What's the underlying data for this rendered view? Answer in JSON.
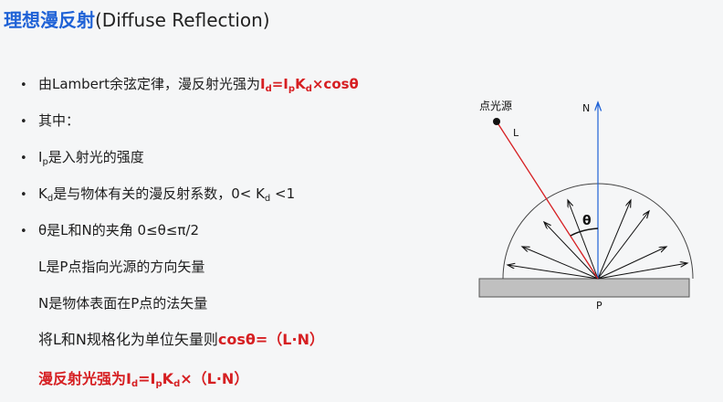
{
  "title": {
    "cn": "理想漫反射",
    "en": "(Diffuse Reflection)"
  },
  "bullets": {
    "b1": {
      "prefix": "由Lambert余弦定律，漫反射光强为",
      "formula_i": "I",
      "formula_d": "d",
      "formula_eq": "=I",
      "formula_p": "p",
      "formula_k": "K",
      "formula_kd": "d",
      "formula_tail": "×cosθ"
    },
    "b2": {
      "text": "其中："
    },
    "b3": {
      "i": "I",
      "p": "p",
      "text": "是入射光的强度"
    },
    "b4": {
      "k": "K",
      "d": "d",
      "text": "是与物体有关的漫反射系数，0< K",
      "d2": "d",
      "tail": " <1"
    },
    "b5": {
      "text": "θ是L和N的夹角 0≤θ≤π/2"
    },
    "l1": {
      "text": "L是P点指向光源的方向矢量"
    },
    "l2": {
      "text": "N是物体表面在P点的法矢量"
    },
    "l3": {
      "prefix": "将L和N规格化为单位矢量则",
      "formula": "cosθ=（L·N）"
    },
    "l4": {
      "prefix": "漫反射光强为",
      "i": "I",
      "d": "d",
      "eq": "=I",
      "p": "p",
      "k": "K",
      "kd": "d",
      "tail": "×（L·N）"
    }
  },
  "diagram": {
    "light_label": "点光源",
    "L_label": "L",
    "N_label": "N",
    "P_label": "P",
    "theta_label": "θ"
  },
  "colors": {
    "title_blue": "#1f62d6",
    "formula_red": "#d61f22",
    "normal_blue": "#1f62d6",
    "surface_gray": "#c0c0c0"
  }
}
